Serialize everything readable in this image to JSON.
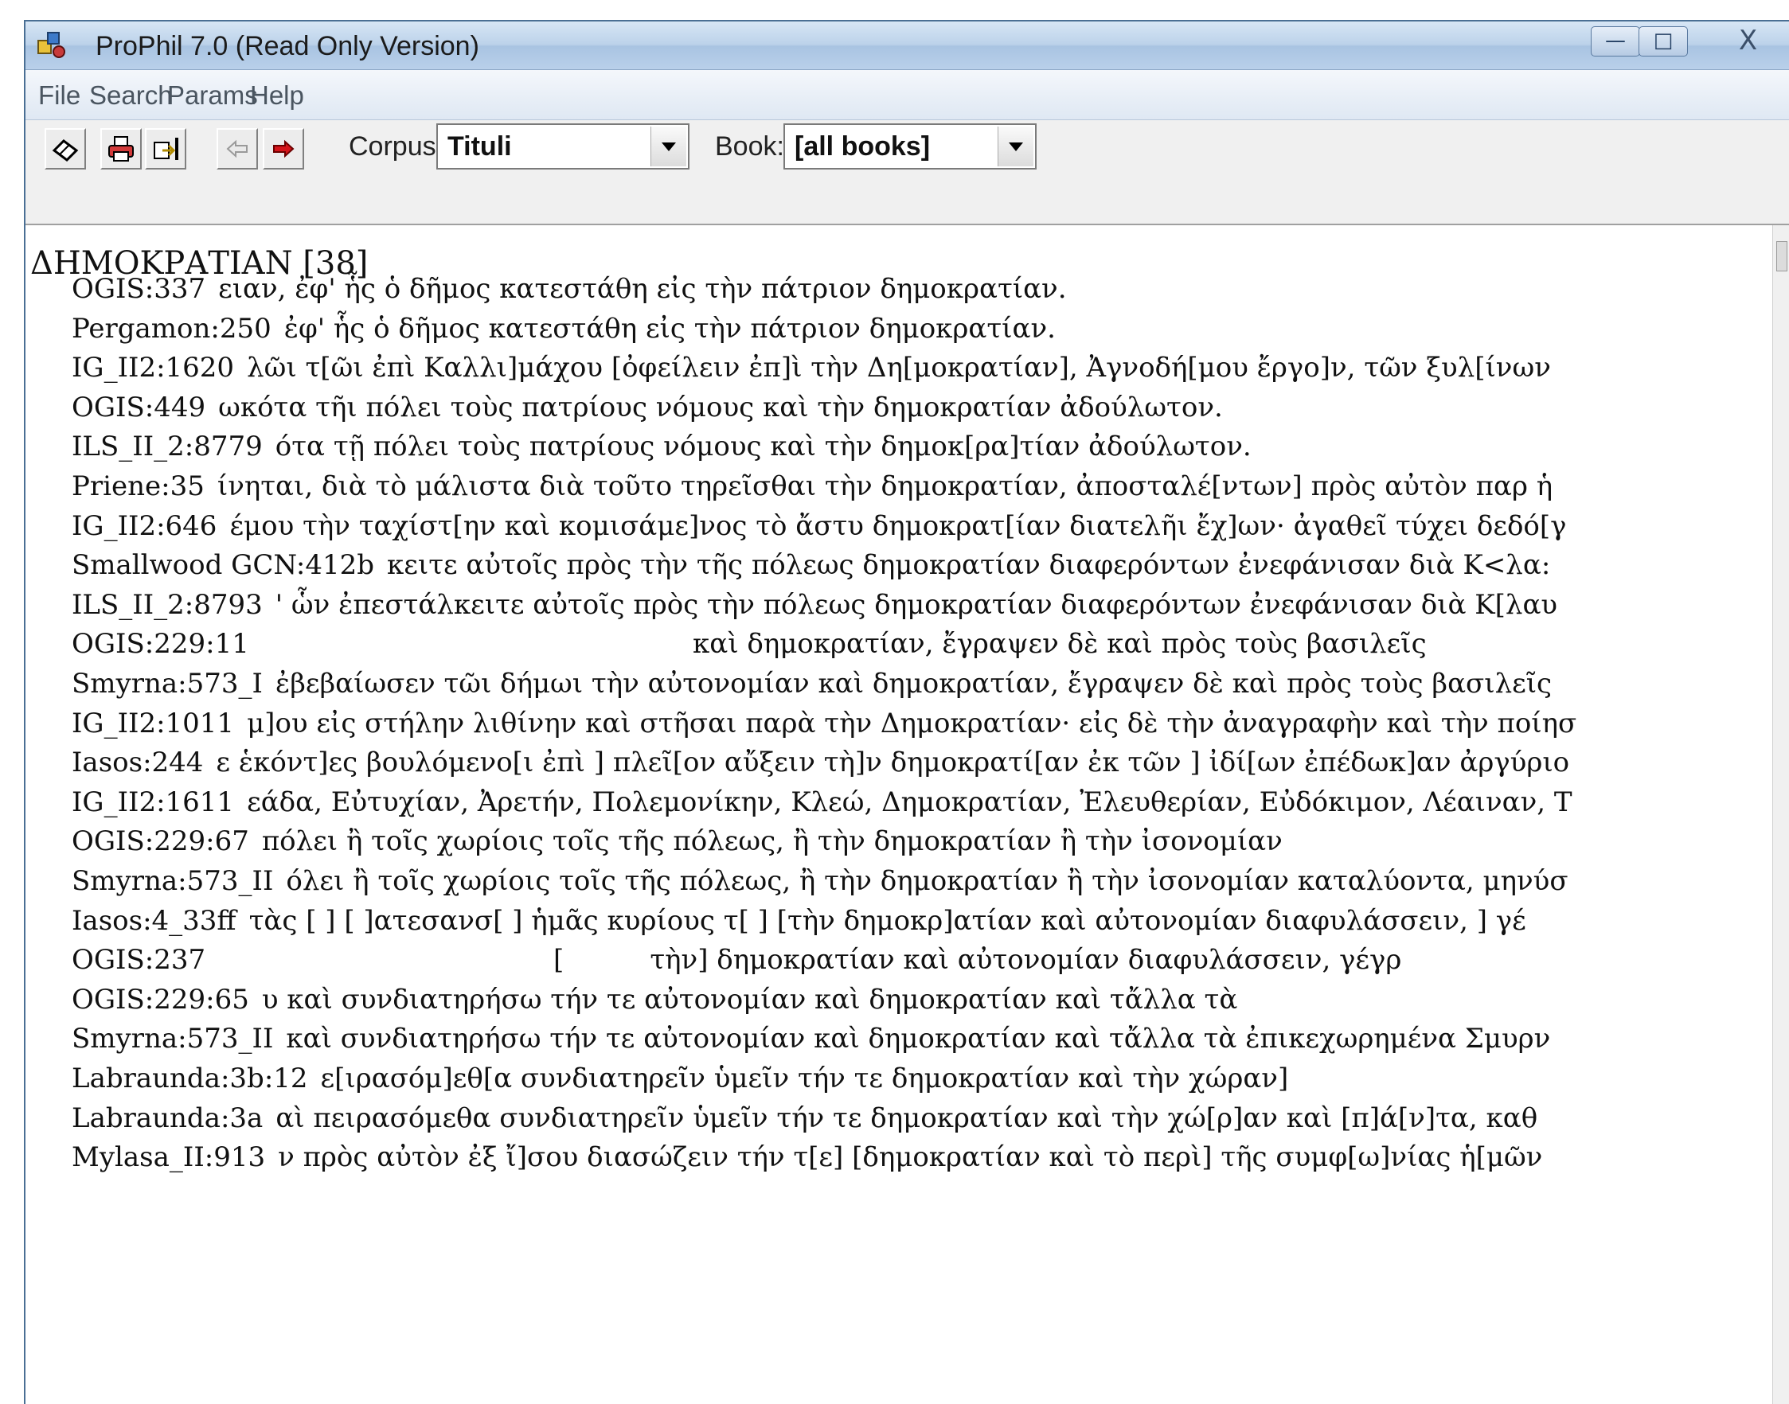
{
  "window": {
    "title": "ProPhil 7.0 (Read Only Version)",
    "controls": {
      "minimize": "—",
      "maximize": "□",
      "close": "X"
    }
  },
  "menu": [
    "File",
    "Search",
    "Params",
    "Help"
  ],
  "toolbar": {
    "corpus_label": "Corpus:",
    "corpus_value": "Tituli",
    "book_label": "Book:",
    "book_value": "[all books]"
  },
  "results": {
    "heading": "ΔΗΜΟΚΡΑΤΙΑΝ [38]",
    "rows": [
      {
        "ref": "OGIS:337",
        "text": "ειαν, ἐφ' ἧς ὁ δῆμος κατεστάθη εἰς τὴν πάτριον δημοκρατίαν."
      },
      {
        "ref": "Pergamon:250",
        "text": "ἐφ' ἧς ὁ δῆμος κατεστάθη εἰς τὴν πάτριον δημοκρατίαν."
      },
      {
        "ref": "IG_II2:1620",
        "text": "λῶι τ[ῶι ἐπὶ Καλλι]μάχου [ὀφείλειν ἐπ]ὶ τὴν Δη[μοκρατίαν], Ἀγνοδή[μου ἔργο]ν, τῶν ξυλ[ίνων"
      },
      {
        "ref": "OGIS:449",
        "text": "ωκότα τῆι πόλει τοὺς πατρίους νόμους καὶ τὴν δημοκρατίαν ἀδούλωτον."
      },
      {
        "ref": "ILS_II_2:8779",
        "text": "ότα τῇ πόλει τοὺς πατρίους νόμους καὶ τὴν δημοκ[ρα]τίαν ἀδούλωτον."
      },
      {
        "ref": "Priene:35",
        "text": "ίνηται, διὰ τὸ μάλιστα διὰ τοῦτο τηρεῖσθαι τὴν δημοκρατίαν, ἀποσταλέ[ντων] πρὸς αὐτὸν παρ ἡ"
      },
      {
        "ref": "IG_II2:646",
        "text": "έμου τὴν ταχίστ[ην καὶ κομισάμε]νος τὸ ἄστυ δημοκρατ[ίαν διατελῆι ἔχ]ων· ἀγαθεῖ τύχει δεδό[γ"
      },
      {
        "ref": "Smallwood GCN:412b",
        "text": "κειτε αὐτοῖς πρὸς τὴν τῆς πόλεως δημοκρατίαν διαφερόντων ἐνεφάνισαν διὰ Κ<λα:"
      },
      {
        "ref": "ILS_II_2:8793",
        "text": "' ὧν ἐπεστάλκειτε αὐτοῖς πρὸς τὴν πόλεως δημοκρατίαν διαφερόντων ἐνεφάνισαν διὰ Κ[λαυ"
      },
      {
        "ref": "OGIS:229:11",
        "text": "καὶ δημοκρατίαν, ἔγραψεν δὲ καὶ πρὸς τοὺς βασιλεῖς"
      },
      {
        "ref": "Smyrna:573_I",
        "text": "ἐβεβαίωσεν τῶι δήμωι τὴν αὐτονομίαν καὶ δημοκρατίαν, ἔγραψεν δὲ καὶ πρὸς τοὺς βασιλεῖς"
      },
      {
        "ref": "IG_II2:1011",
        "text": "μ]ου εἰς στήλην λιθίνην καὶ στῆσαι παρὰ τὴν Δημοκρατίαν· εἰς δὲ τὴν ἀναγραφὴν καὶ τὴν ποίησ"
      },
      {
        "ref": "Iasos:244",
        "text": "ε ἑκόντ]ες βουλόμενο[ι ἐπὶ ] πλεῖ[ον αὔξειν τὴ]ν δημοκρατί[αν ἐκ τῶν ] ἰδί[ων ἐπέδωκ]αν ἀργύριο"
      },
      {
        "ref": "IG_II2:1611",
        "text": "εάδα, Εὐτυχίαν, Ἀρετήν, Πολεμονίκην, Κλεώ, Δημοκρατίαν, Ἐλευθερίαν, Εὐδόκιμον, Λέαιναν, Τ"
      },
      {
        "ref": "OGIS:229:67",
        "text": "πόλει ἢ τοῖς χωρίοις τοῖς τῆς πόλεως, ἢ τὴν δημοκρατίαν ἢ τὴν ἰσονομίαν"
      },
      {
        "ref": "Smyrna:573_II",
        "text": "όλει ἢ τοῖς χωρίοις τοῖς τῆς πόλεως, ἢ τὴν δημοκρατίαν ἢ τὴν ἰσονομίαν καταλύοντα, μηνύσ"
      },
      {
        "ref": "Iasos:4_33ff",
        "text": "τὰς [ ] [ ]ατεσανσ[ ] ἡμᾶς κυρίους τ[ ] [τὴν δημοκρ]ατίαν καὶ αὐτονομίαν διαφυλάσσειν, ] γέ"
      },
      {
        "ref": "OGIS:237",
        "text": "[          τὴν] δημοκρατίαν καὶ αὐτονομίαν διαφυλάσσειν, γέγρ"
      },
      {
        "ref": "OGIS:229:65",
        "text": "υ καὶ συνδιατηρήσω τήν τε αὐτονομίαν καὶ δημοκρατίαν καὶ τἄλλα τὰ"
      },
      {
        "ref": "Smyrna:573_II",
        "text": "καὶ συνδιατηρήσω τήν τε αὐτονομίαν καὶ δημοκρατίαν καὶ τἄλλα τὰ ἐπικεχωρημένα Σμυρν"
      },
      {
        "ref": "Labraunda:3b:12",
        "text": "ε[ιρασόμ]εθ[α συνδιατηρεῖν ὑμεῖν τήν τε δημοκρατίαν καὶ τὴν χώραν]"
      },
      {
        "ref": "Labraunda:3a",
        "text": "αὶ πειρασόμεθα συνδιατηρεῖν ὑμεῖν τήν τε δημοκρατίαν καὶ τὴν χώ[ρ]αν καὶ [π]ά[ν]τα, καθ"
      },
      {
        "ref": "Mylasa_II:913",
        "text": "ν πρὸς αὐτὸν ἐξ ἴ]σου διασώζειν τήν τ[ε] [δημοκρατίαν καὶ τὸ περὶ] τῆς συμφ[ω]νίας ἡ[μῶν"
      }
    ]
  }
}
